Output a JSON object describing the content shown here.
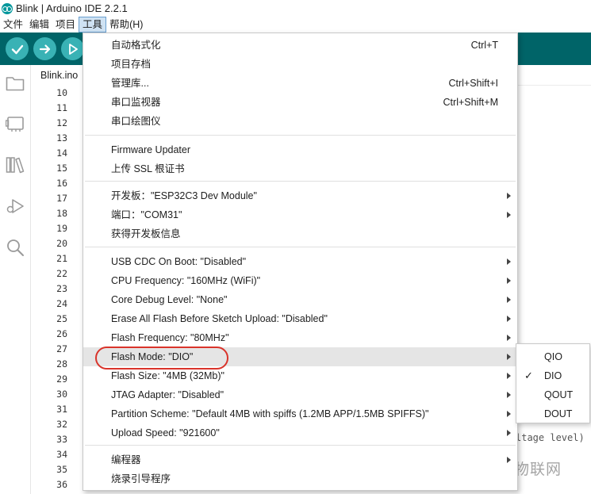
{
  "window": {
    "title": "Blink | Arduino IDE 2.2.1"
  },
  "menubar": [
    "文件",
    "编辑",
    "项目",
    "工具",
    "帮助(H)"
  ],
  "toolbar": {
    "verify_icon": "checkmark-icon",
    "upload_icon": "arrow-right-icon",
    "debug_icon": "debug-icon",
    "colors": {
      "toolbar": "#006468",
      "button": "#39b2b5"
    }
  },
  "editor": {
    "tab": "Blink.ino",
    "line_numbers": [
      "10",
      "11",
      "12",
      "13",
      "14",
      "15",
      "16",
      "17",
      "18",
      "19",
      "20",
      "21",
      "22",
      "23",
      "24",
      "25",
      "26",
      "27",
      "28",
      "29",
      "30",
      "31",
      "32",
      "33",
      "34",
      "35",
      "36"
    ],
    "code_fragment": "ltage level)"
  },
  "tools_menu": {
    "groups": [
      [
        {
          "label": "自动格式化",
          "shortcut": "Ctrl+T"
        },
        {
          "label": "项目存档",
          "shortcut": ""
        },
        {
          "label": "管理库...",
          "shortcut": "Ctrl+Shift+I"
        },
        {
          "label": "串口监视器",
          "shortcut": "Ctrl+Shift+M"
        },
        {
          "label": "串口绘图仪",
          "shortcut": ""
        }
      ],
      [
        {
          "label": "Firmware Updater",
          "shortcut": ""
        },
        {
          "label": "上传 SSL 根证书",
          "shortcut": ""
        }
      ],
      [
        {
          "label": "开发板：\"ESP32C3 Dev Module\"",
          "submenu": true
        },
        {
          "label": "端口：\"COM31\"",
          "submenu": true
        },
        {
          "label": "获得开发板信息",
          "submenu": false
        }
      ],
      [
        {
          "label": "USB CDC On Boot: \"Disabled\"",
          "submenu": true
        },
        {
          "label": "CPU Frequency: \"160MHz (WiFi)\"",
          "submenu": true
        },
        {
          "label": "Core Debug Level: \"None\"",
          "submenu": true
        },
        {
          "label": "Erase All Flash Before Sketch Upload: \"Disabled\"",
          "submenu": true
        },
        {
          "label": "Flash Frequency: \"80MHz\"",
          "submenu": true
        },
        {
          "label": "Flash Mode: \"DIO\"",
          "submenu": true,
          "selected": true
        },
        {
          "label": "Flash Size: \"4MB (32Mb)\"",
          "submenu": true
        },
        {
          "label": "JTAG Adapter: \"Disabled\"",
          "submenu": true
        },
        {
          "label": "Partition Scheme: \"Default 4MB with spiffs (1.2MB APP/1.5MB SPIFFS)\"",
          "submenu": true
        },
        {
          "label": "Upload Speed: \"921600\"",
          "submenu": true
        }
      ],
      [
        {
          "label": "编程器",
          "submenu": true
        },
        {
          "label": "烧录引导程序",
          "submenu": false
        }
      ]
    ],
    "annotation_color": "#d9342b"
  },
  "flash_mode_submenu": {
    "options": [
      "QIO",
      "DIO",
      "QOUT",
      "DOUT"
    ],
    "checked": "DIO"
  },
  "watermark": "知乎 @橙子物联网"
}
